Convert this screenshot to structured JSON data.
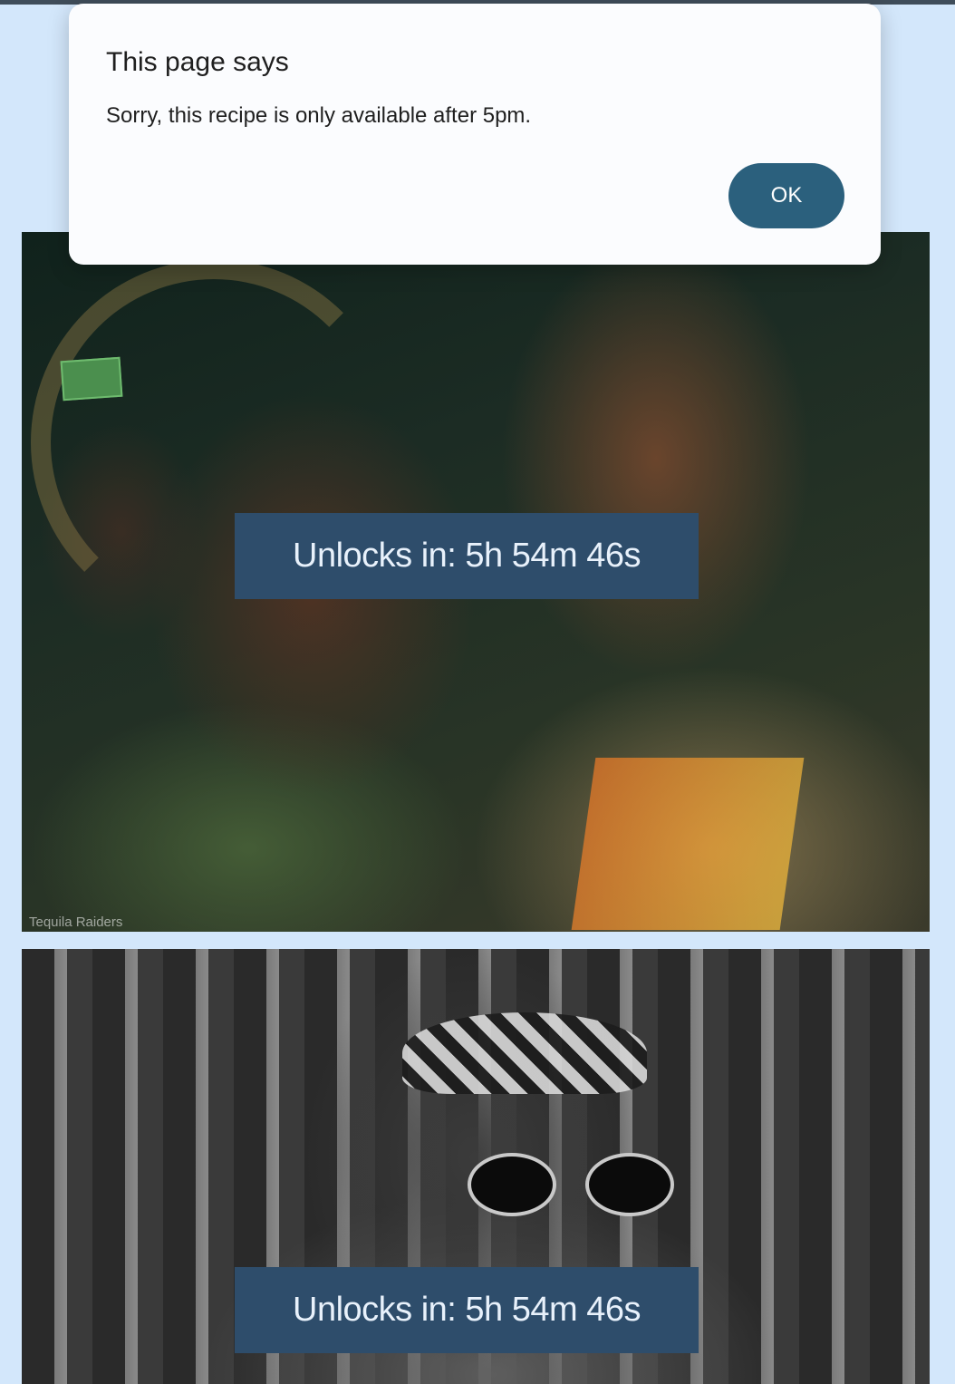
{
  "dialog": {
    "title": "This page says",
    "message": "Sorry, this recipe is only available after 5pm.",
    "ok_label": "OK"
  },
  "recipes": [
    {
      "unlock_text": "Unlocks in: 5h 54m 46s",
      "watermark": "Tequila Raiders"
    },
    {
      "unlock_text": "Unlocks in: 5h 54m 46s"
    }
  ],
  "colors": {
    "page_background": "#d3e7fb",
    "label_background": "#2e4d6b",
    "button_background": "#2b607d"
  }
}
